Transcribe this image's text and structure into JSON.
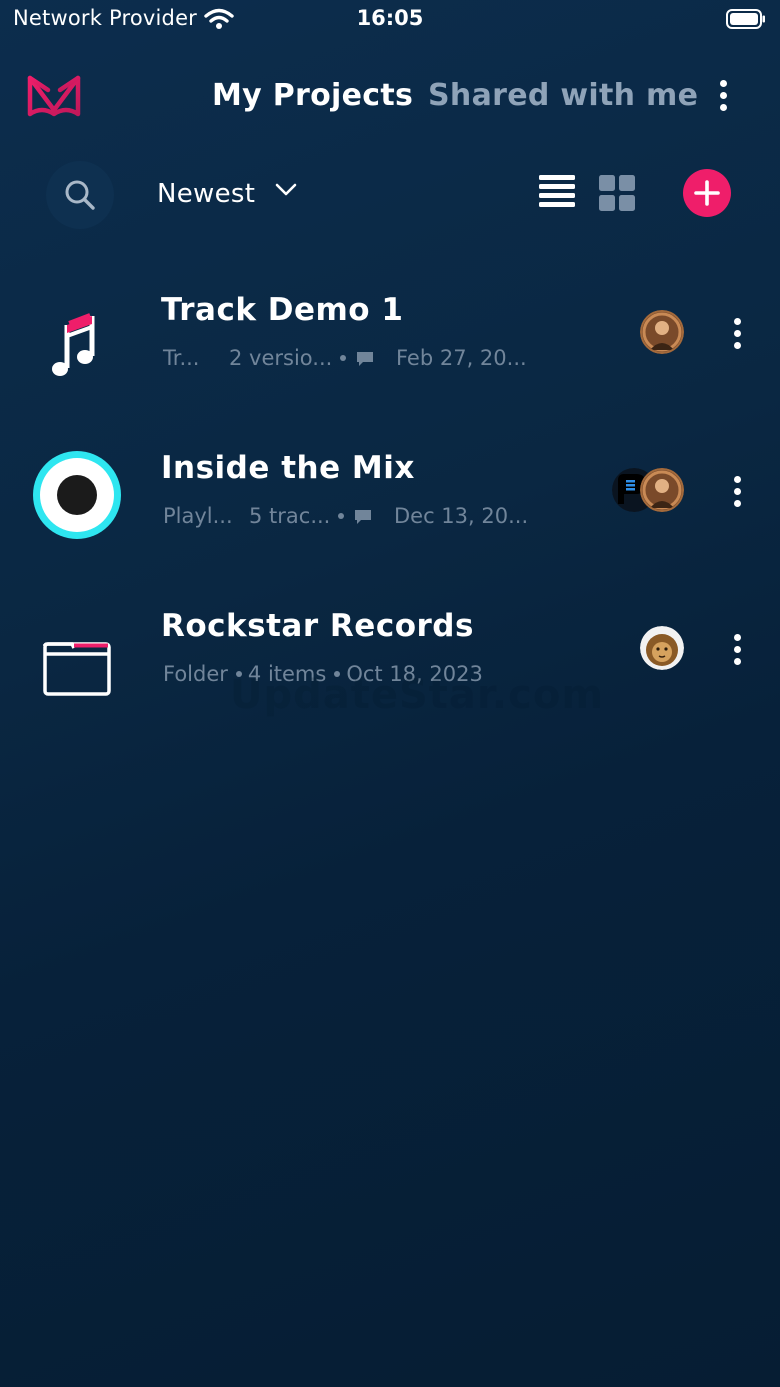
{
  "status_bar": {
    "carrier": "Network Provider",
    "time": "16:05"
  },
  "nav": {
    "tabs": [
      {
        "label": "My Projects",
        "active": true
      },
      {
        "label": "Shared with me",
        "active": false
      }
    ]
  },
  "toolbar": {
    "sort_label": "Newest"
  },
  "projects": [
    {
      "title": "Track Demo 1",
      "meta_type": "Tr...",
      "meta_count": "2 versio...",
      "meta_date": "Feb 27, 20...",
      "icon": "music-note-icon"
    },
    {
      "title": "Inside the Mix",
      "meta_type": "Playl...",
      "meta_count": "5 trac...",
      "meta_date": "Dec 13, 20...",
      "icon": "playlist-disc-icon"
    },
    {
      "title": "Rockstar Records",
      "meta_type": "Folder",
      "meta_count": "4 items",
      "meta_date": "Oct 18, 2023",
      "icon": "folder-icon"
    }
  ],
  "watermark": "UpdateStar.com",
  "colors": {
    "accent": "#ef1e6a",
    "disc_ring": "#2ee6f0",
    "meta_text": "#71859a",
    "inactive_tab": "#8fa3b8"
  }
}
